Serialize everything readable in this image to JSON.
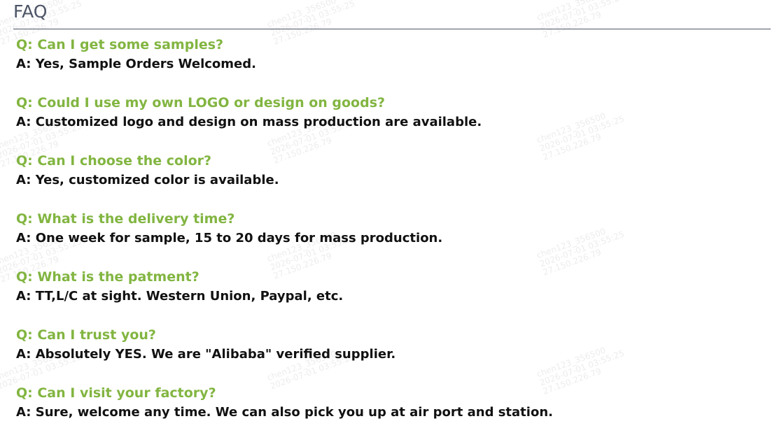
{
  "header": {
    "title": "FAQ"
  },
  "faq": [
    {
      "q": "Q: Can I get some samples?",
      "a": "A: Yes, Sample Orders Welcomed."
    },
    {
      "q": "Q: Could I use my own LOGO or design on goods?",
      "a": "A: Customized logo and design on mass production are available."
    },
    {
      "q": "Q: Can I choose the color?",
      "a": "A: Yes, customized color is available."
    },
    {
      "q": "Q: What is the delivery time?",
      "a": "A: One week for sample, 15 to 20 days for mass production."
    },
    {
      "q": "Q: What is the patment?",
      "a": "A: TT,L/C at sight. Western Union, Paypal, etc."
    },
    {
      "q": "Q: Can I trust you?",
      "a": "A: Absolutely YES. We are \"Alibaba\" verified supplier."
    },
    {
      "q": "Q: Can I visit your factory?",
      "a": "A: Sure, welcome any time. We can also pick you up at air port and station."
    }
  ],
  "watermark": {
    "line1": "chen123_356500",
    "line2": "2026-07-01 03:55:25",
    "line3": "27.150.226.79"
  }
}
